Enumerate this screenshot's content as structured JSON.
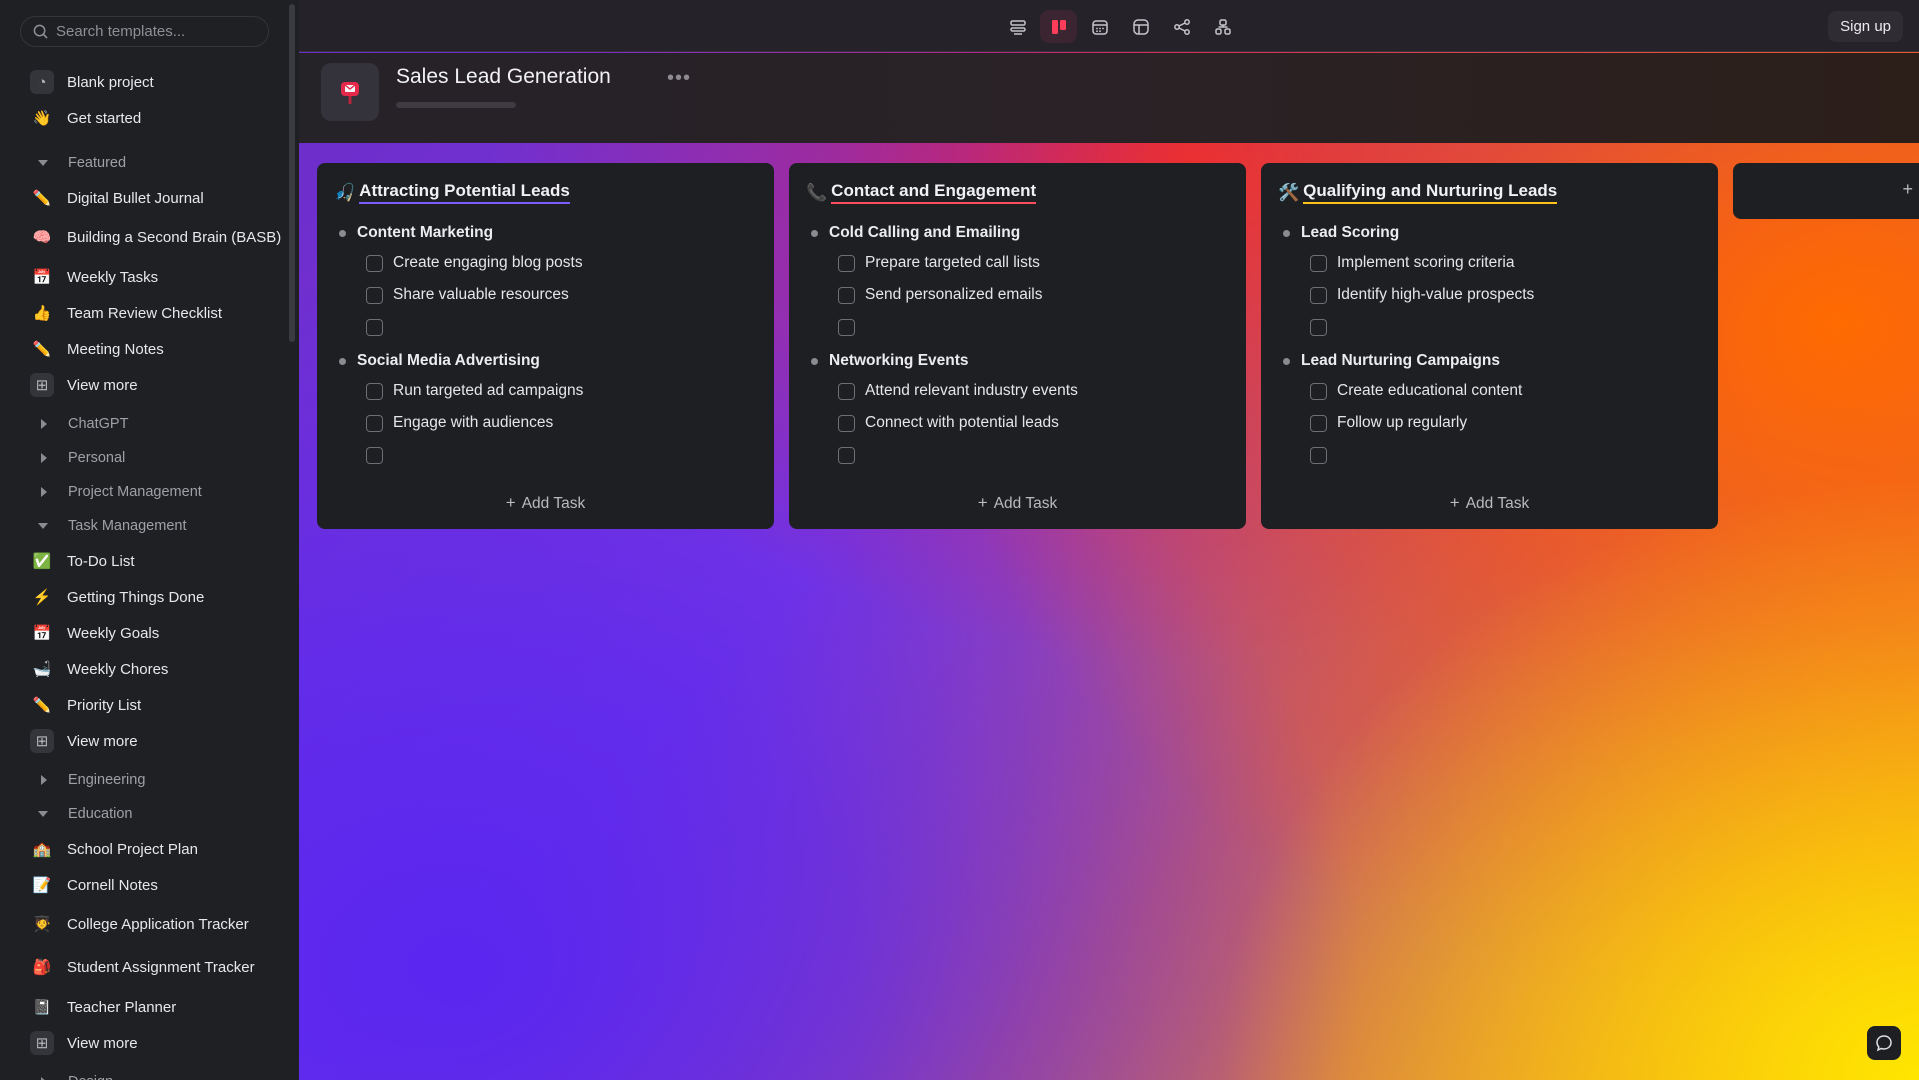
{
  "search": {
    "placeholder": "Search templates..."
  },
  "sidebar": {
    "top_items": [
      {
        "label": "Blank project",
        "icon": "blank-project-icon",
        "glyph": "◔"
      },
      {
        "label": "Get started",
        "icon": "waving-hand-icon",
        "glyph": "👋"
      }
    ],
    "featured": {
      "label": "Featured",
      "items": [
        {
          "label": "Digital Bullet Journal",
          "icon": "pencil-icon",
          "glyph": "✏️"
        },
        {
          "label": "Building a Second Brain (BASB)",
          "icon": "brain-icon",
          "glyph": "🧠"
        },
        {
          "label": "Weekly Tasks",
          "icon": "calendar-icon",
          "glyph": "📅"
        },
        {
          "label": "Team Review Checklist",
          "icon": "thumbs-up-icon",
          "glyph": "👍"
        },
        {
          "label": "Meeting Notes",
          "icon": "pencil-icon",
          "glyph": "✏️"
        },
        {
          "label": "View more",
          "icon": "grid-icon",
          "glyph": "⊞"
        }
      ]
    },
    "collapsed_1": [
      "ChatGPT",
      "Personal",
      "Project Management"
    ],
    "task_management": {
      "label": "Task Management",
      "items": [
        {
          "label": "To-Do List",
          "icon": "check-mark-icon",
          "glyph": "✅"
        },
        {
          "label": "Getting Things Done",
          "icon": "lightning-icon",
          "glyph": "⚡"
        },
        {
          "label": "Weekly Goals",
          "icon": "calendar-icon",
          "glyph": "📅"
        },
        {
          "label": "Weekly Chores",
          "icon": "bathtub-icon",
          "glyph": "🛁"
        },
        {
          "label": "Priority List",
          "icon": "pencil-icon",
          "glyph": "✏️"
        },
        {
          "label": "View more",
          "icon": "grid-icon",
          "glyph": "⊞"
        }
      ]
    },
    "collapsed_2": [
      "Engineering"
    ],
    "education": {
      "label": "Education",
      "items": [
        {
          "label": "School Project Plan",
          "icon": "school-icon",
          "glyph": "🏫"
        },
        {
          "label": "Cornell Notes",
          "icon": "memo-icon",
          "glyph": "📝"
        },
        {
          "label": "College Application Tracker",
          "icon": "student-icon",
          "glyph": "🧑‍🎓"
        },
        {
          "label": "Student Assignment Tracker",
          "icon": "backpack-icon",
          "glyph": "🎒"
        },
        {
          "label": "Teacher Planner",
          "icon": "notebook-icon",
          "glyph": "📓"
        },
        {
          "label": "View more",
          "icon": "grid-icon",
          "glyph": "⊞"
        }
      ]
    },
    "collapsed_3": [
      "Design"
    ]
  },
  "topbar": {
    "signup_label": "Sign up"
  },
  "project": {
    "title": "Sales Lead Generation",
    "more": "•••",
    "icon": "mailbox-icon"
  },
  "board": {
    "add_task_label": "Add Task",
    "columns": [
      {
        "title": "Attracting Potential Leads",
        "emoji": "🎣",
        "underline_color": "#7b5cff",
        "groups": [
          {
            "title": "Content Marketing",
            "tasks": [
              "Create engaging blog posts",
              "Share valuable resources",
              ""
            ]
          },
          {
            "title": "Social Media Advertising",
            "tasks": [
              "Run targeted ad campaigns",
              "Engage with audiences",
              ""
            ]
          }
        ]
      },
      {
        "title": "Contact and Engagement",
        "emoji": "📞",
        "underline_color": "#ff4d5e",
        "groups": [
          {
            "title": "Cold Calling and Emailing",
            "tasks": [
              "Prepare targeted call lists",
              "Send personalized emails",
              ""
            ]
          },
          {
            "title": "Networking Events",
            "tasks": [
              "Attend relevant industry events",
              "Connect with potential leads",
              ""
            ]
          }
        ]
      },
      {
        "title": "Qualifying and Nurturing Leads",
        "emoji": "🛠️",
        "underline_color": "#ffc21a",
        "groups": [
          {
            "title": "Lead Scoring",
            "tasks": [
              "Implement scoring criteria",
              "Identify high-value prospects",
              ""
            ]
          },
          {
            "title": "Lead Nurturing Campaigns",
            "tasks": [
              "Create educational content",
              "Follow up regularly",
              ""
            ]
          }
        ]
      }
    ]
  },
  "partial_column": {
    "label": "+"
  },
  "colors": {
    "accent": "#e5294a",
    "sidebar_bg": "#1f2024",
    "card_bg": "#1e1f23"
  }
}
